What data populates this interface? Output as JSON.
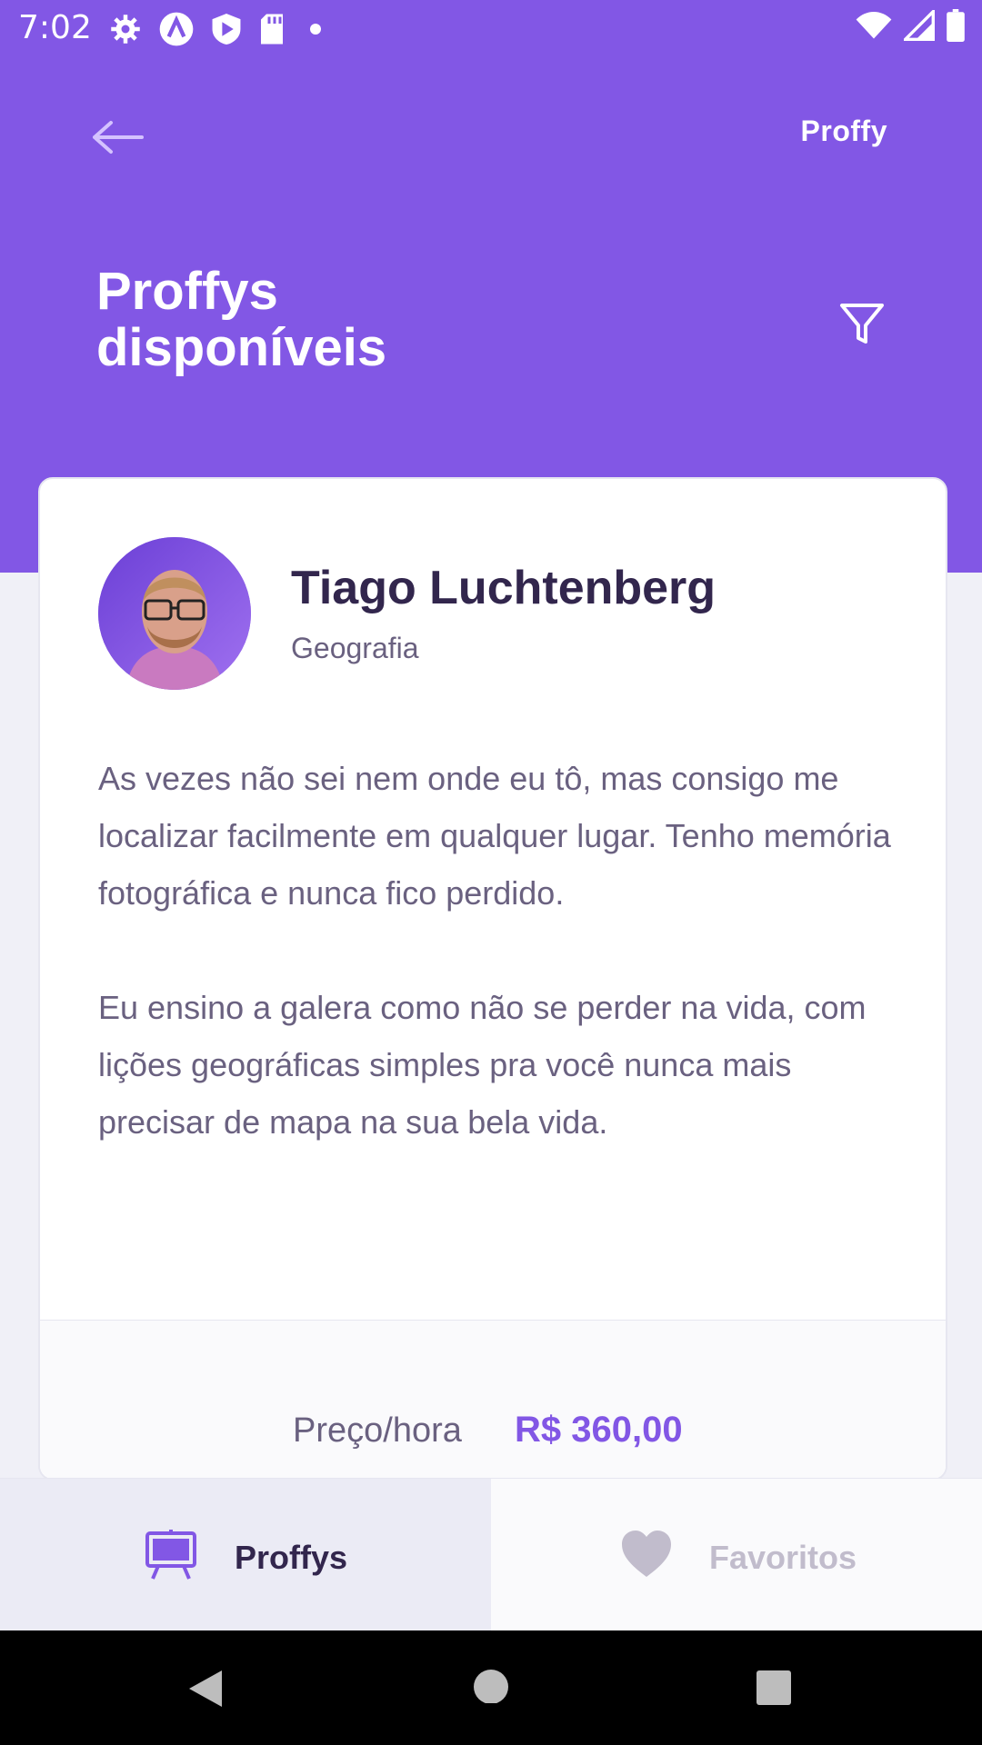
{
  "status_bar": {
    "time": "7:02",
    "left_icons": [
      "gear-icon",
      "a-icon",
      "shield-play-icon",
      "sd-card-icon",
      "dot-icon"
    ],
    "right_icons": [
      "wifi-icon",
      "signal-icon",
      "battery-icon"
    ]
  },
  "header": {
    "brand": "Proffy",
    "title": "Proffys disponíveis",
    "back_icon": "arrow-left-icon",
    "filter_icon": "filter-icon",
    "accent_color": "#8257E5"
  },
  "teacher_card": {
    "name": "Tiago Luchtenberg",
    "subject": "Geografia",
    "bio": [
      "As vezes não sei nem onde eu tô, mas consigo me localizar facilmente em qualquer lugar. Tenho memória fotográfica e nunca fico perdido.",
      "Eu ensino a galera como não se perder na vida, com lições geográficas simples pra você nunca mais precisar de mapa na sua bela vida."
    ],
    "price_label": "Preço/hora",
    "price_value": "R$ 360,00"
  },
  "tabbar": {
    "tabs": [
      {
        "label": "Proffys",
        "icon": "easel-icon",
        "active": true
      },
      {
        "label": "Favoritos",
        "icon": "heart-icon",
        "active": false
      }
    ]
  },
  "navbar": {
    "buttons": [
      "back-triangle-icon",
      "home-circle-icon",
      "recents-square-icon"
    ]
  }
}
